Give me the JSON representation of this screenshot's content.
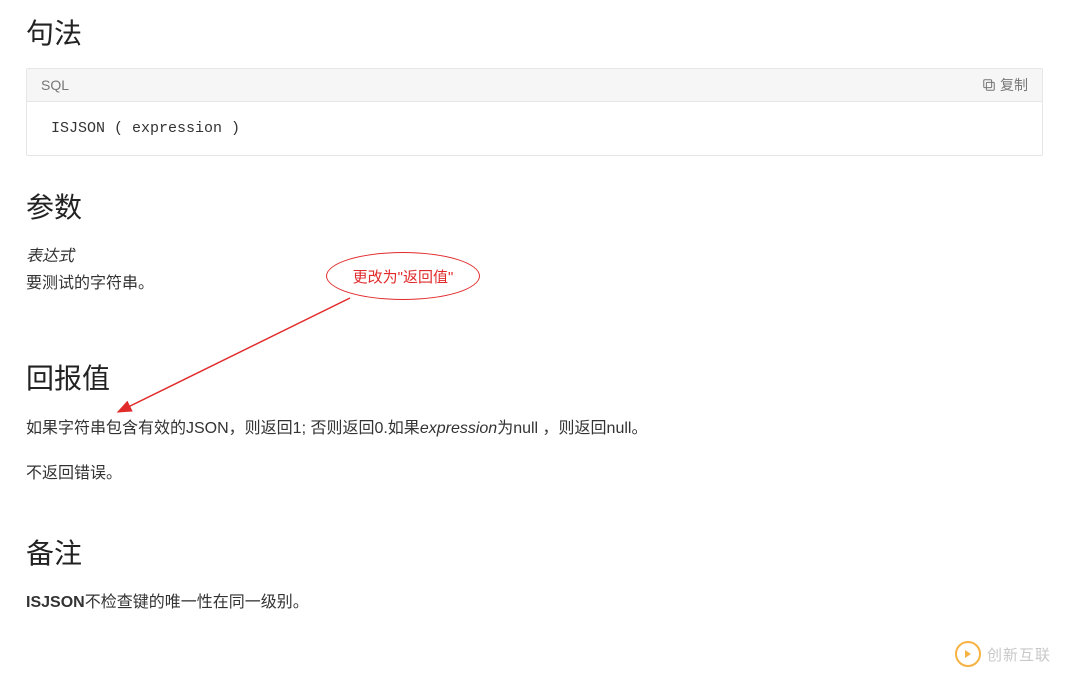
{
  "syntax": {
    "heading": "句法",
    "language_label": "SQL",
    "copy_label": "复制",
    "code": "ISJSON ( expression )"
  },
  "params": {
    "heading": "参数",
    "name": "表达式",
    "description": "要测试的字符串。"
  },
  "return": {
    "heading": "回报值",
    "line1_prefix": "如果字符串包含有效的JSON，则返回1; 否则返回0.如果",
    "line1_em": "expression",
    "line1_suffix": "为null ，则返回null。",
    "line2": "不返回错误。"
  },
  "remarks": {
    "heading": "备注",
    "strong": "ISJSON",
    "text": "不检查键的唯一性在同一级别。"
  },
  "annotation": {
    "text": "更改为\"返回值\""
  },
  "watermark": {
    "text": "创新互联"
  }
}
